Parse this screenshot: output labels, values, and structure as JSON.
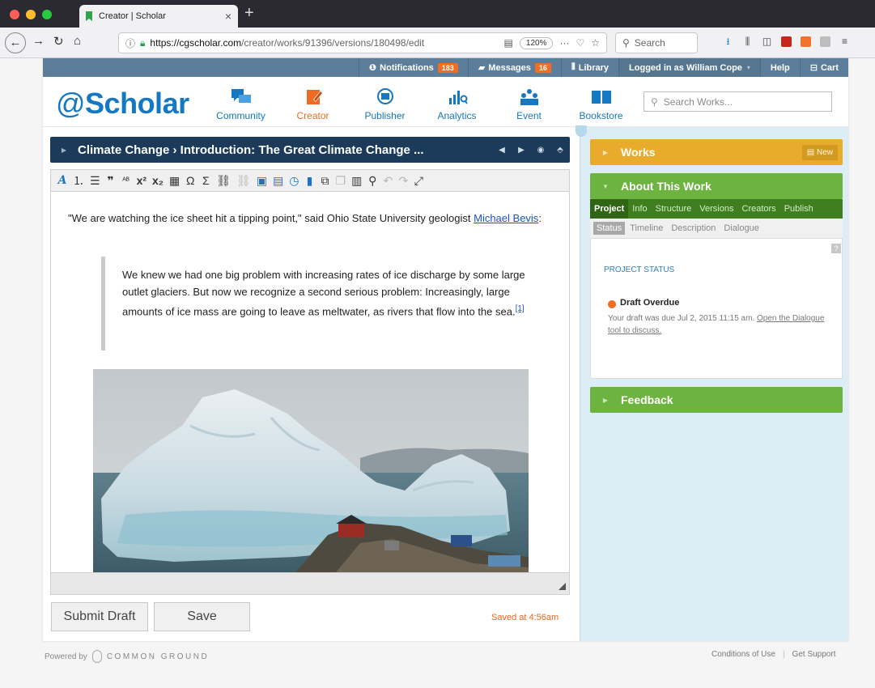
{
  "browser": {
    "tab_title": "Creator | Scholar",
    "url_host": "https://cgscholar.com",
    "url_path": "/creator/works/91396/versions/180498/edit",
    "zoom": "120%",
    "search_placeholder": "Search"
  },
  "topstrip": {
    "notifications_label": "Notifications",
    "notifications_count": "183",
    "messages_label": "Messages",
    "messages_count": "16",
    "library_label": "Library",
    "logged_in_label": "Logged in as William Cope",
    "help_label": "Help",
    "cart_label": "Cart"
  },
  "header": {
    "logo_text": "Scholar",
    "nav": [
      {
        "label": "Community"
      },
      {
        "label": "Creator"
      },
      {
        "label": "Publisher"
      },
      {
        "label": "Analytics"
      },
      {
        "label": "Event"
      },
      {
        "label": "Bookstore"
      }
    ],
    "search_placeholder": "Search Works..."
  },
  "editor": {
    "title": "Climate Change › Introduction: The Great Climate Change ...",
    "intro": "\"We are watching the ice sheet hit a tipping point,\" said Ohio State University geologist ",
    "intro_link": "Michael Bevis",
    "intro_end": ":",
    "quote": "We knew we had one big problem with increasing rates of ice discharge by some large outlet glaciers. But now we recognize a second serious problem: Increasingly, large amounts of ice mass are going to leave as meltwater, as rivers that flow into the sea.",
    "footnote": "[1]",
    "submit_label": "Submit Draft",
    "save_label": "Save",
    "saved_status": "Saved at 4:56am"
  },
  "sidebar": {
    "works_label": "Works",
    "new_label": "New",
    "about_label": "About This Work",
    "about_tabs": [
      "Project",
      "Info",
      "Structure",
      "Versions",
      "Creators",
      "Publish"
    ],
    "sub_tabs": [
      "Status",
      "Timeline",
      "Description",
      "Dialogue"
    ],
    "help_mark": "?",
    "project_status_label": "PROJECT STATUS",
    "draft_title": "Draft Overdue",
    "draft_note": "Your draft was due Jul 2, 2015 11:15 am. ",
    "draft_link": "Open the Dialogue tool to discuss.",
    "feedback_label": "Feedback"
  },
  "footer": {
    "powered_by": "Powered by",
    "brand": "COMMON GROUND",
    "conditions": "Conditions of Use",
    "support": "Get Support"
  }
}
